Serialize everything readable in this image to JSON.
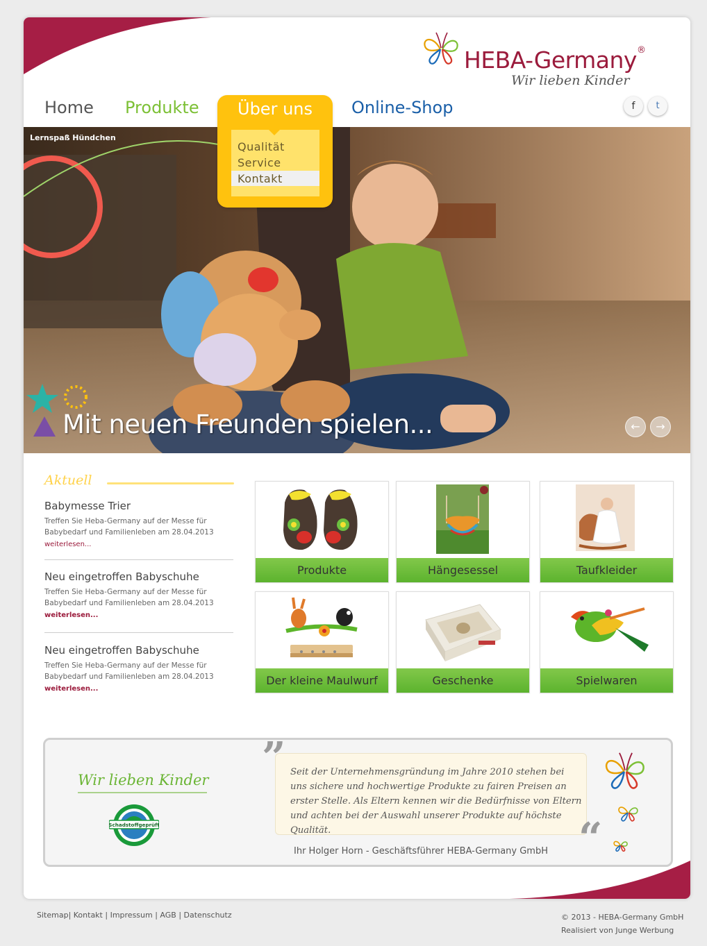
{
  "brand": {
    "name": "HEBA-Germany",
    "registered": "®",
    "tagline": "Wir lieben Kinder",
    "colors": {
      "primary": "#9b1b3c",
      "green": "#7cc035",
      "yellow": "#ffc20e",
      "blue": "#1a5fa8"
    }
  },
  "nav": {
    "home": "Home",
    "produkte": "Produkte",
    "ueber_uns": "Über uns",
    "online_shop": "Online-Shop",
    "dropdown": [
      "Qualität",
      "Service",
      "Kontakt"
    ],
    "dropdown_active": "Kontakt"
  },
  "social": {
    "facebook": "f",
    "twitter": "t"
  },
  "hero": {
    "caption": "Lernspaß Hündchen",
    "headline": "Mit neuen Freunden spielen...",
    "prev_icon": "←",
    "next_icon": "→"
  },
  "news": {
    "heading": "Aktuell",
    "items": [
      {
        "title": "Babymesse Trier",
        "text": "Treffen Sie Heba-Germany auf der Messe für Babybedarf und Familienleben am 28.04.2013",
        "more": "weiterlesen..."
      },
      {
        "title": "Neu eingetroffen Babyschuhe",
        "text": "Treffen Sie Heba-Germany auf der Messe für Babybedarf und Familienleben am 28.04.2013",
        "more": "weiterlesen..."
      },
      {
        "title": "Neu eingetroffen Babyschuhe",
        "text": "Treffen Sie Heba-Germany auf der Messe für Babybedarf und Familienleben am 28.04.2013",
        "more": "weiterlesen..."
      }
    ]
  },
  "tiles": [
    "Produkte",
    "Hängesessel",
    "Taufkleider",
    "Der kleine Maulwurf",
    "Geschenke",
    "Spielwaren"
  ],
  "quote": {
    "title": "Wir lieben Kinder",
    "badge": "Schadstoffgeprüft",
    "text": "Seit der Unternehmensgründung im Jahre 2010 stehen bei uns sichere und hochwertige Produkte zu fairen Preisen an erster Stelle. Als Eltern kennen wir die Bedürfnisse von Eltern und achten bei der Auswahl unserer Produkte auf höchste Qualität.",
    "author": "Ihr Holger Horn - Geschäftsführer HEBA-Germany GmbH"
  },
  "footer": {
    "links": [
      "Sitemap",
      "Kontakt",
      "Impressum",
      "AGB",
      "Datenschutz"
    ],
    "copyright": "© 2013 - HEBA-Germany GmbH",
    "credit": "Realisiert von Junge Werbung"
  }
}
